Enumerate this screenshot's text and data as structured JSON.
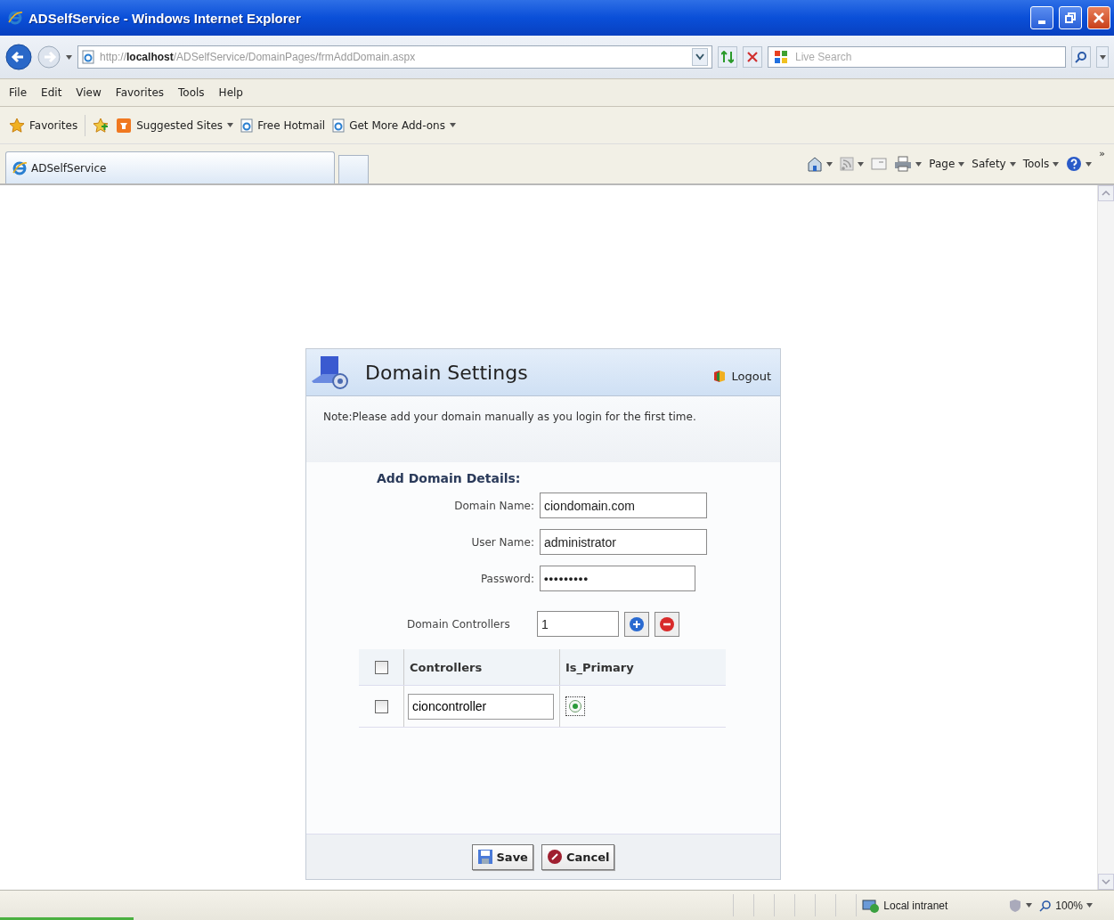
{
  "window": {
    "title": "ADSelfService - Windows Internet Explorer"
  },
  "address_bar": {
    "url": "http://**localhost**/ADSelfService/DomainPages/frmAddDomain.aspx"
  },
  "search": {
    "placeholder": "Live Search"
  },
  "menu": [
    "File",
    "Edit",
    "View",
    "Favorites",
    "Tools",
    "Help"
  ],
  "favorites_bar": {
    "favorites": "Favorites",
    "links": [
      {
        "label": "Suggested Sites",
        "dropdown": true,
        "kind": "suggested"
      },
      {
        "label": "Free Hotmail",
        "dropdown": false,
        "kind": "page"
      },
      {
        "label": "Get More Add-ons",
        "dropdown": true,
        "kind": "page"
      }
    ]
  },
  "tabs": [
    {
      "label": "ADSelfService",
      "selected": true
    }
  ],
  "command_bar": {
    "items": [
      "Page",
      "Safety",
      "Tools"
    ],
    "more": "»"
  },
  "dialog": {
    "title": "Domain Settings",
    "logout": "Logout",
    "note": "Note:Please add your domain manually as you login for the first time.",
    "section_title": "Add Domain Details:",
    "fields": [
      {
        "label": "Domain Name:",
        "value": "ciondomain.com",
        "kind": "text"
      },
      {
        "label": "User Name:",
        "value": "administrator",
        "kind": "text"
      },
      {
        "label": "Password:",
        "value": "•••••••••",
        "kind": "password"
      }
    ],
    "domain_controllers": {
      "label": "Domain Controllers",
      "value": "1"
    },
    "table": {
      "header_checked": false,
      "columns": [
        "Controllers",
        "Is_Primary"
      ],
      "rows": [
        {
          "checked": false,
          "controller": "cioncontroller",
          "primary": true
        }
      ]
    },
    "buttons": [
      {
        "label": "Save",
        "kind": "save"
      },
      {
        "label": "Cancel",
        "kind": "cancel"
      }
    ]
  },
  "status_bar": {
    "zone": "Local intranet",
    "zoom": "100%"
  }
}
